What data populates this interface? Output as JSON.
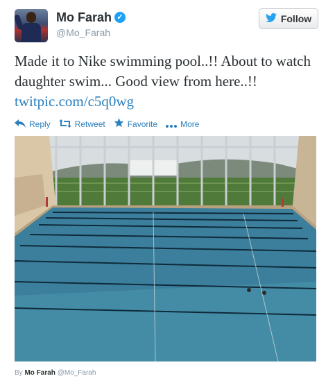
{
  "user": {
    "name": "Mo Farah",
    "handle": "@Mo_Farah",
    "verified_mark": "✓"
  },
  "follow_button": {
    "label": "Follow",
    "icon": "twitter-bird-icon"
  },
  "tweet": {
    "text": "Made it to Nike swimming pool..!! About to watch daughter swim... Good view from here..!!",
    "link_text": "twitpic.com/c5q0wg"
  },
  "actions": [
    {
      "label": "Reply",
      "icon": "reply-icon"
    },
    {
      "label": "Retweet",
      "icon": "retweet-icon"
    },
    {
      "label": "Favorite",
      "icon": "star-icon"
    },
    {
      "label": "More",
      "icon": "more-icon"
    }
  ],
  "byline": {
    "prefix": "By",
    "name": "Mo Farah",
    "handle": "@Mo_Farah"
  },
  "colors": {
    "link": "#2a7fbf",
    "verified": "#1da1f2",
    "muted": "#8899a6"
  }
}
